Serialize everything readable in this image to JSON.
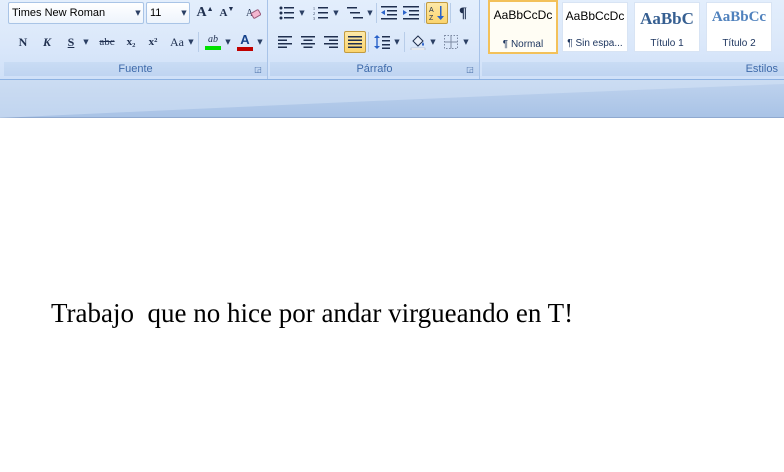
{
  "font_group": {
    "label": "Fuente",
    "font_name": "Times New Roman",
    "font_size": "11",
    "grow_font": "A",
    "shrink_font": "A",
    "bold": "N",
    "italic": "K",
    "underline": "S",
    "strikethrough": "abc",
    "subscript": "x₂",
    "superscript": "x²",
    "change_case": "Aa",
    "highlight": "ab",
    "font_color": "A",
    "highlight_color": "#00e000",
    "font_color_bar": "#c00000"
  },
  "paragraph_group": {
    "label": "Párrafo",
    "pilcrow": "¶"
  },
  "styles_group": {
    "label": "Estilos",
    "tiles": [
      {
        "sample": "AaBbCcDc",
        "name": "¶ Normal"
      },
      {
        "sample": "AaBbCcDc",
        "name": "¶ Sin espa..."
      },
      {
        "sample": "AaBbC",
        "name": "Título 1"
      },
      {
        "sample": "AaBbCc",
        "name": "Título 2"
      }
    ]
  },
  "document": {
    "text": "Trabajo  que no hice por andar virgueando en T!"
  }
}
